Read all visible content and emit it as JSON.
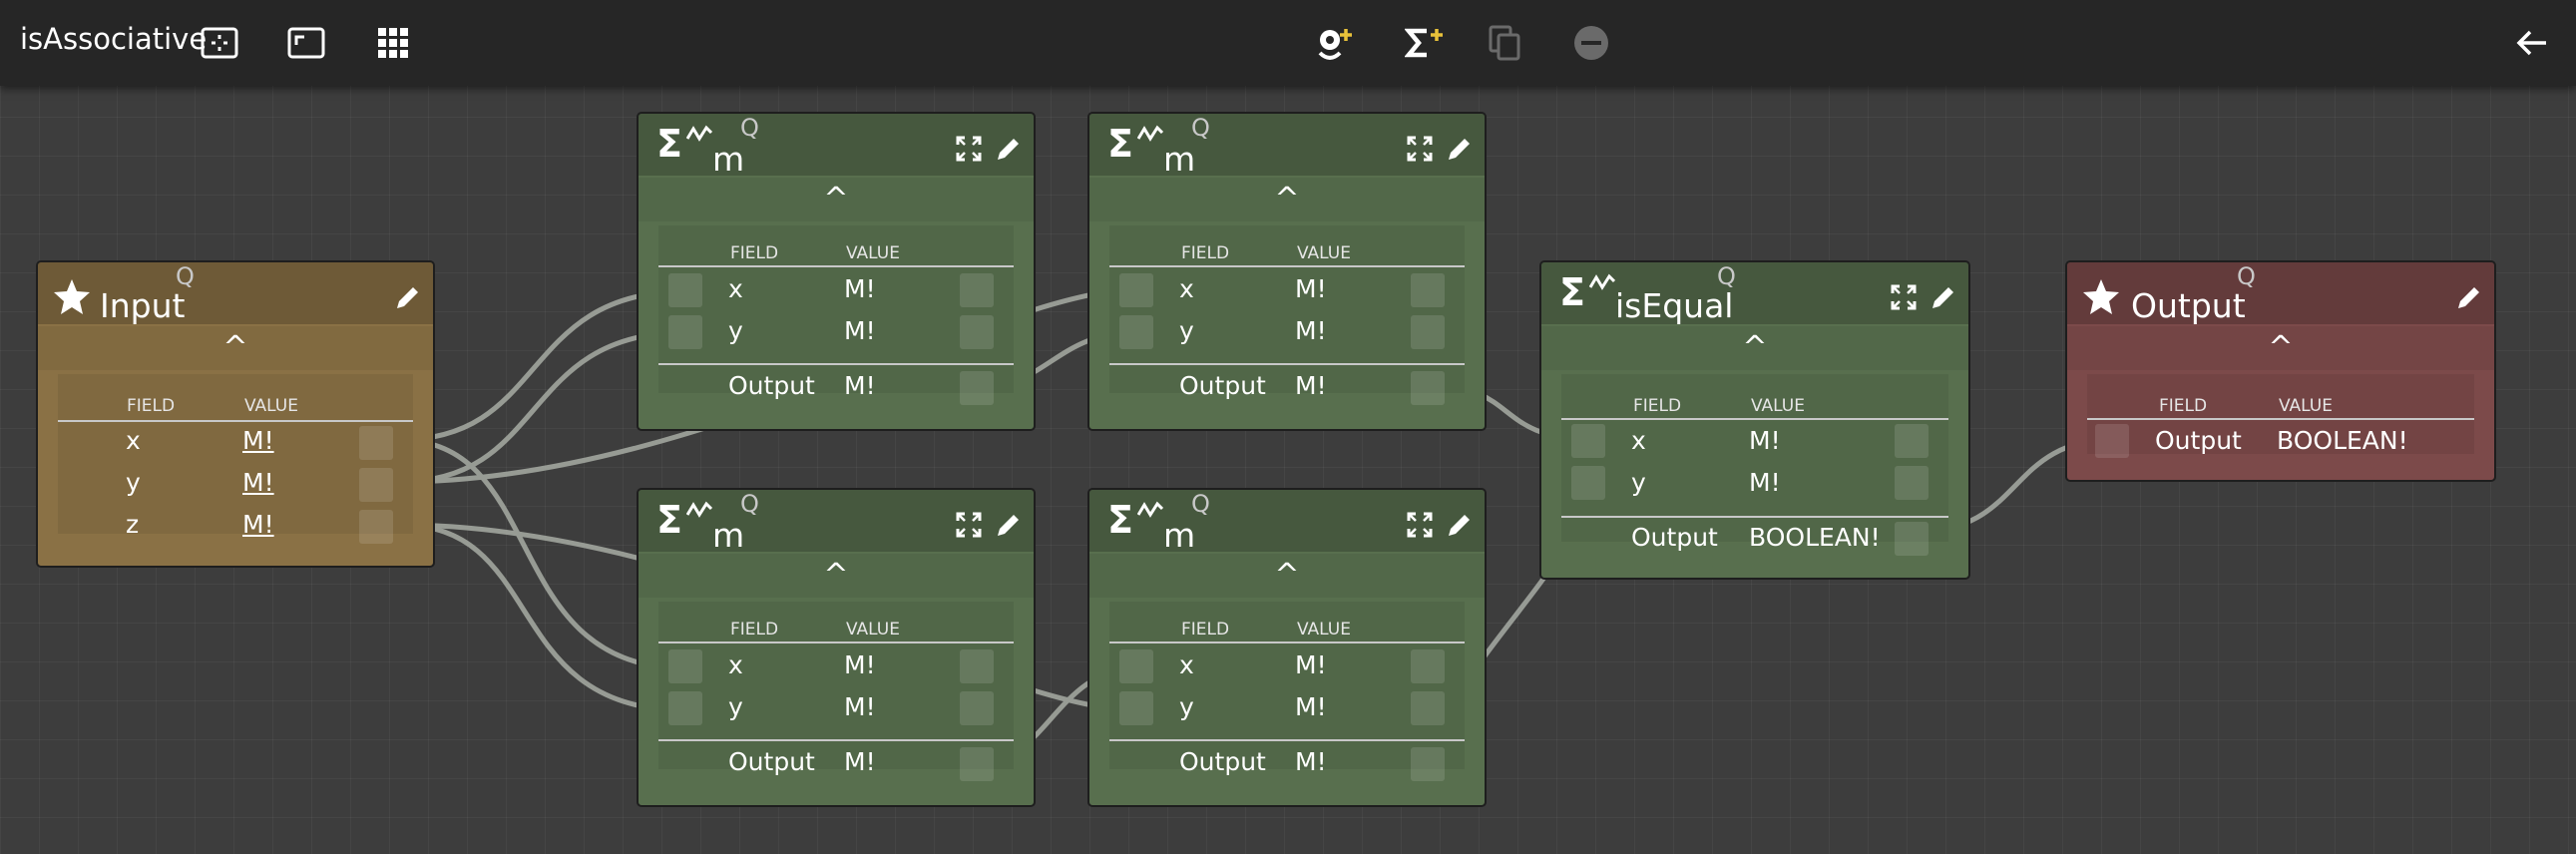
{
  "app": {
    "title": "isAssociative"
  },
  "toolbar": {
    "left_icons": [
      "fit-view-icon",
      "aspect-frame-icon",
      "grid-icon"
    ],
    "center_icons": [
      "add-node-icon",
      "add-sum-icon",
      "copy-icon",
      "remove-icon"
    ],
    "right_icons": [
      "back-arrow-icon"
    ],
    "accent_color": "#e8c23a"
  },
  "columns": {
    "field": "FIELD",
    "value": "VALUE"
  },
  "q": "Q",
  "caret": "^",
  "sigma": "Σ",
  "input_node": {
    "title": "Input",
    "fields": [
      {
        "name": "x",
        "value": "M!"
      },
      {
        "name": "y",
        "value": "M!"
      },
      {
        "name": "z",
        "value": "M!"
      }
    ]
  },
  "m_nodes": [
    {
      "title": "m",
      "fields": [
        {
          "name": "x",
          "value": "M!"
        },
        {
          "name": "y",
          "value": "M!"
        }
      ],
      "output_label": "Output",
      "output_value": "M!"
    },
    {
      "title": "m",
      "fields": [
        {
          "name": "x",
          "value": "M!"
        },
        {
          "name": "y",
          "value": "M!"
        }
      ],
      "output_label": "Output",
      "output_value": "M!"
    },
    {
      "title": "m",
      "fields": [
        {
          "name": "x",
          "value": "M!"
        },
        {
          "name": "y",
          "value": "M!"
        }
      ],
      "output_label": "Output",
      "output_value": "M!"
    },
    {
      "title": "m",
      "fields": [
        {
          "name": "x",
          "value": "M!"
        },
        {
          "name": "y",
          "value": "M!"
        }
      ],
      "output_label": "Output",
      "output_value": "M!"
    }
  ],
  "isequal_node": {
    "title": "isEqual",
    "fields": [
      {
        "name": "x",
        "value": "M!"
      },
      {
        "name": "y",
        "value": "M!"
      }
    ],
    "output_label": "Output",
    "output_value": "BOOLEAN!"
  },
  "output_node": {
    "title": "Output",
    "fields": [
      {
        "name": "Output",
        "value": "BOOLEAN!"
      }
    ]
  }
}
